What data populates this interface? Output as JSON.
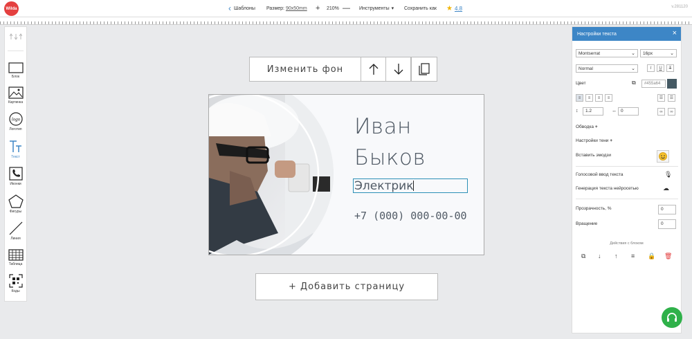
{
  "topbar": {
    "logo": "Wilda",
    "templates": "Шаблоны",
    "size_label": "Размер:",
    "size_value": "90x50mm",
    "zoom": "210%",
    "tools": "Инструменты",
    "save_as": "Сохранить как",
    "rating": "4.8",
    "version": "v.281120"
  },
  "toolbar": [
    {
      "label": "Блок",
      "icon": "block-icon"
    },
    {
      "label": "Картинка",
      "icon": "image-icon"
    },
    {
      "label": "Логотип",
      "icon": "logo-icon"
    },
    {
      "label": "Текст",
      "icon": "text-icon"
    },
    {
      "label": "Иконки",
      "icon": "phone-icon"
    },
    {
      "label": "Фигуры",
      "icon": "pentagon-icon"
    },
    {
      "label": "Линия",
      "icon": "line-icon"
    },
    {
      "label": "Таблица",
      "icon": "table-icon"
    },
    {
      "label": "Коды",
      "icon": "qr-icon"
    }
  ],
  "canvas": {
    "change_bg": "Изменить фон",
    "add_page": "+ Добавить страницу",
    "card": {
      "first_name": "Иван",
      "last_name": "Быков",
      "role": "Электрик",
      "phone": "+7 (000) 000-00-00"
    }
  },
  "panel": {
    "title": "Настройки текста",
    "font": "Montserrat",
    "font_size": "16px",
    "weight": "Normal",
    "color_label": "Цвет",
    "color_value": "#455a64",
    "line_height": "1.2",
    "letter_spacing": "0",
    "stroke": "Обводка",
    "shadow": "Настройки тени",
    "emoji": "Вставить эмодзи",
    "voice": "Голосовой ввод текста",
    "ai": "Генерация текста нейросетью",
    "opacity_label": "Прозрачность, %",
    "opacity_value": "0",
    "rotation_label": "Вращение",
    "rotation_value": "0",
    "actions_label": "Действия с блоком"
  },
  "colors": {
    "accent": "#3d86c6",
    "text_color": "#455a64",
    "support": "#2fb14a",
    "logo": "#e4403f"
  }
}
